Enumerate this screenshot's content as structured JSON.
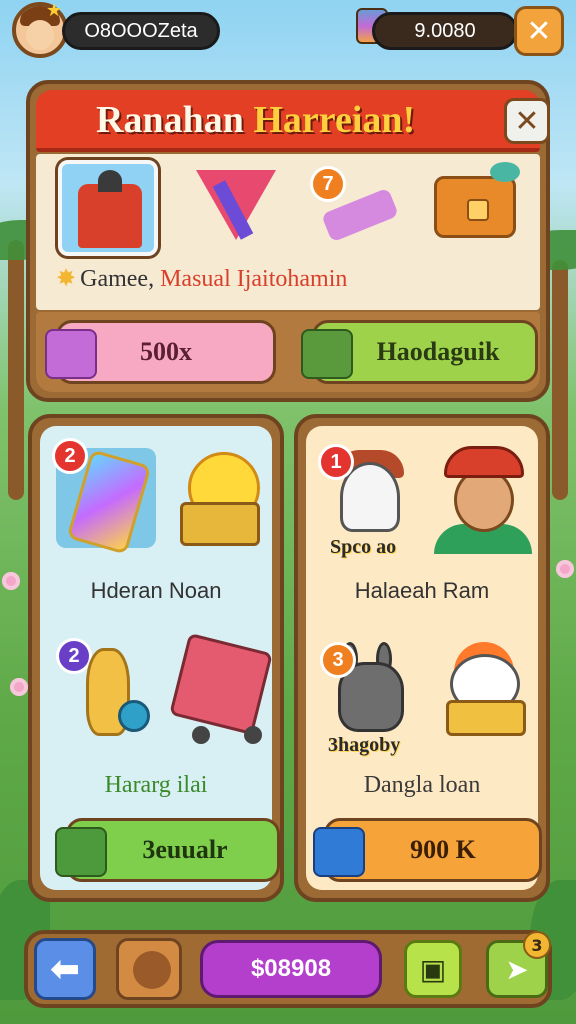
{
  "topbar": {
    "coins": "O8OOOZeta",
    "cash": "9.0080"
  },
  "dialog": {
    "title_part1": "Ranahan ",
    "title_part2": "Harreian!",
    "caption_part1": "Gamee,",
    "caption_part2": "Masual Ijaitohamin",
    "item_badge": "7",
    "btn_left_label": "500x",
    "btn_right_label": "Haodaguik"
  },
  "left_panel": {
    "tile1_badge": "2",
    "label1": "Hderan Noan",
    "tile3_badge": "2",
    "label2": "Hararg ilai",
    "button_label": "3euualr"
  },
  "right_panel": {
    "tile1_badge": "1",
    "tile1_tag": "Spco ao",
    "label1": "Halaeah Ram",
    "tile3_badge": "3",
    "tile3_tag": "3hagoby",
    "label2": "Dangla loan",
    "button_label": "900 K"
  },
  "bottombar": {
    "balance": "$08908",
    "share_badge": "3"
  },
  "icons": {
    "close": "close-icon",
    "back": "arrow-left-icon",
    "map": "map-icon",
    "share": "share-icon"
  },
  "colors": {
    "header_red": "#e23f24",
    "wood": "#9c6a34",
    "pink_button": "#f7a8c2",
    "green_button": "#9dd24a",
    "orange_button": "#f6a43a",
    "purple_balance": "#b33fcc"
  }
}
